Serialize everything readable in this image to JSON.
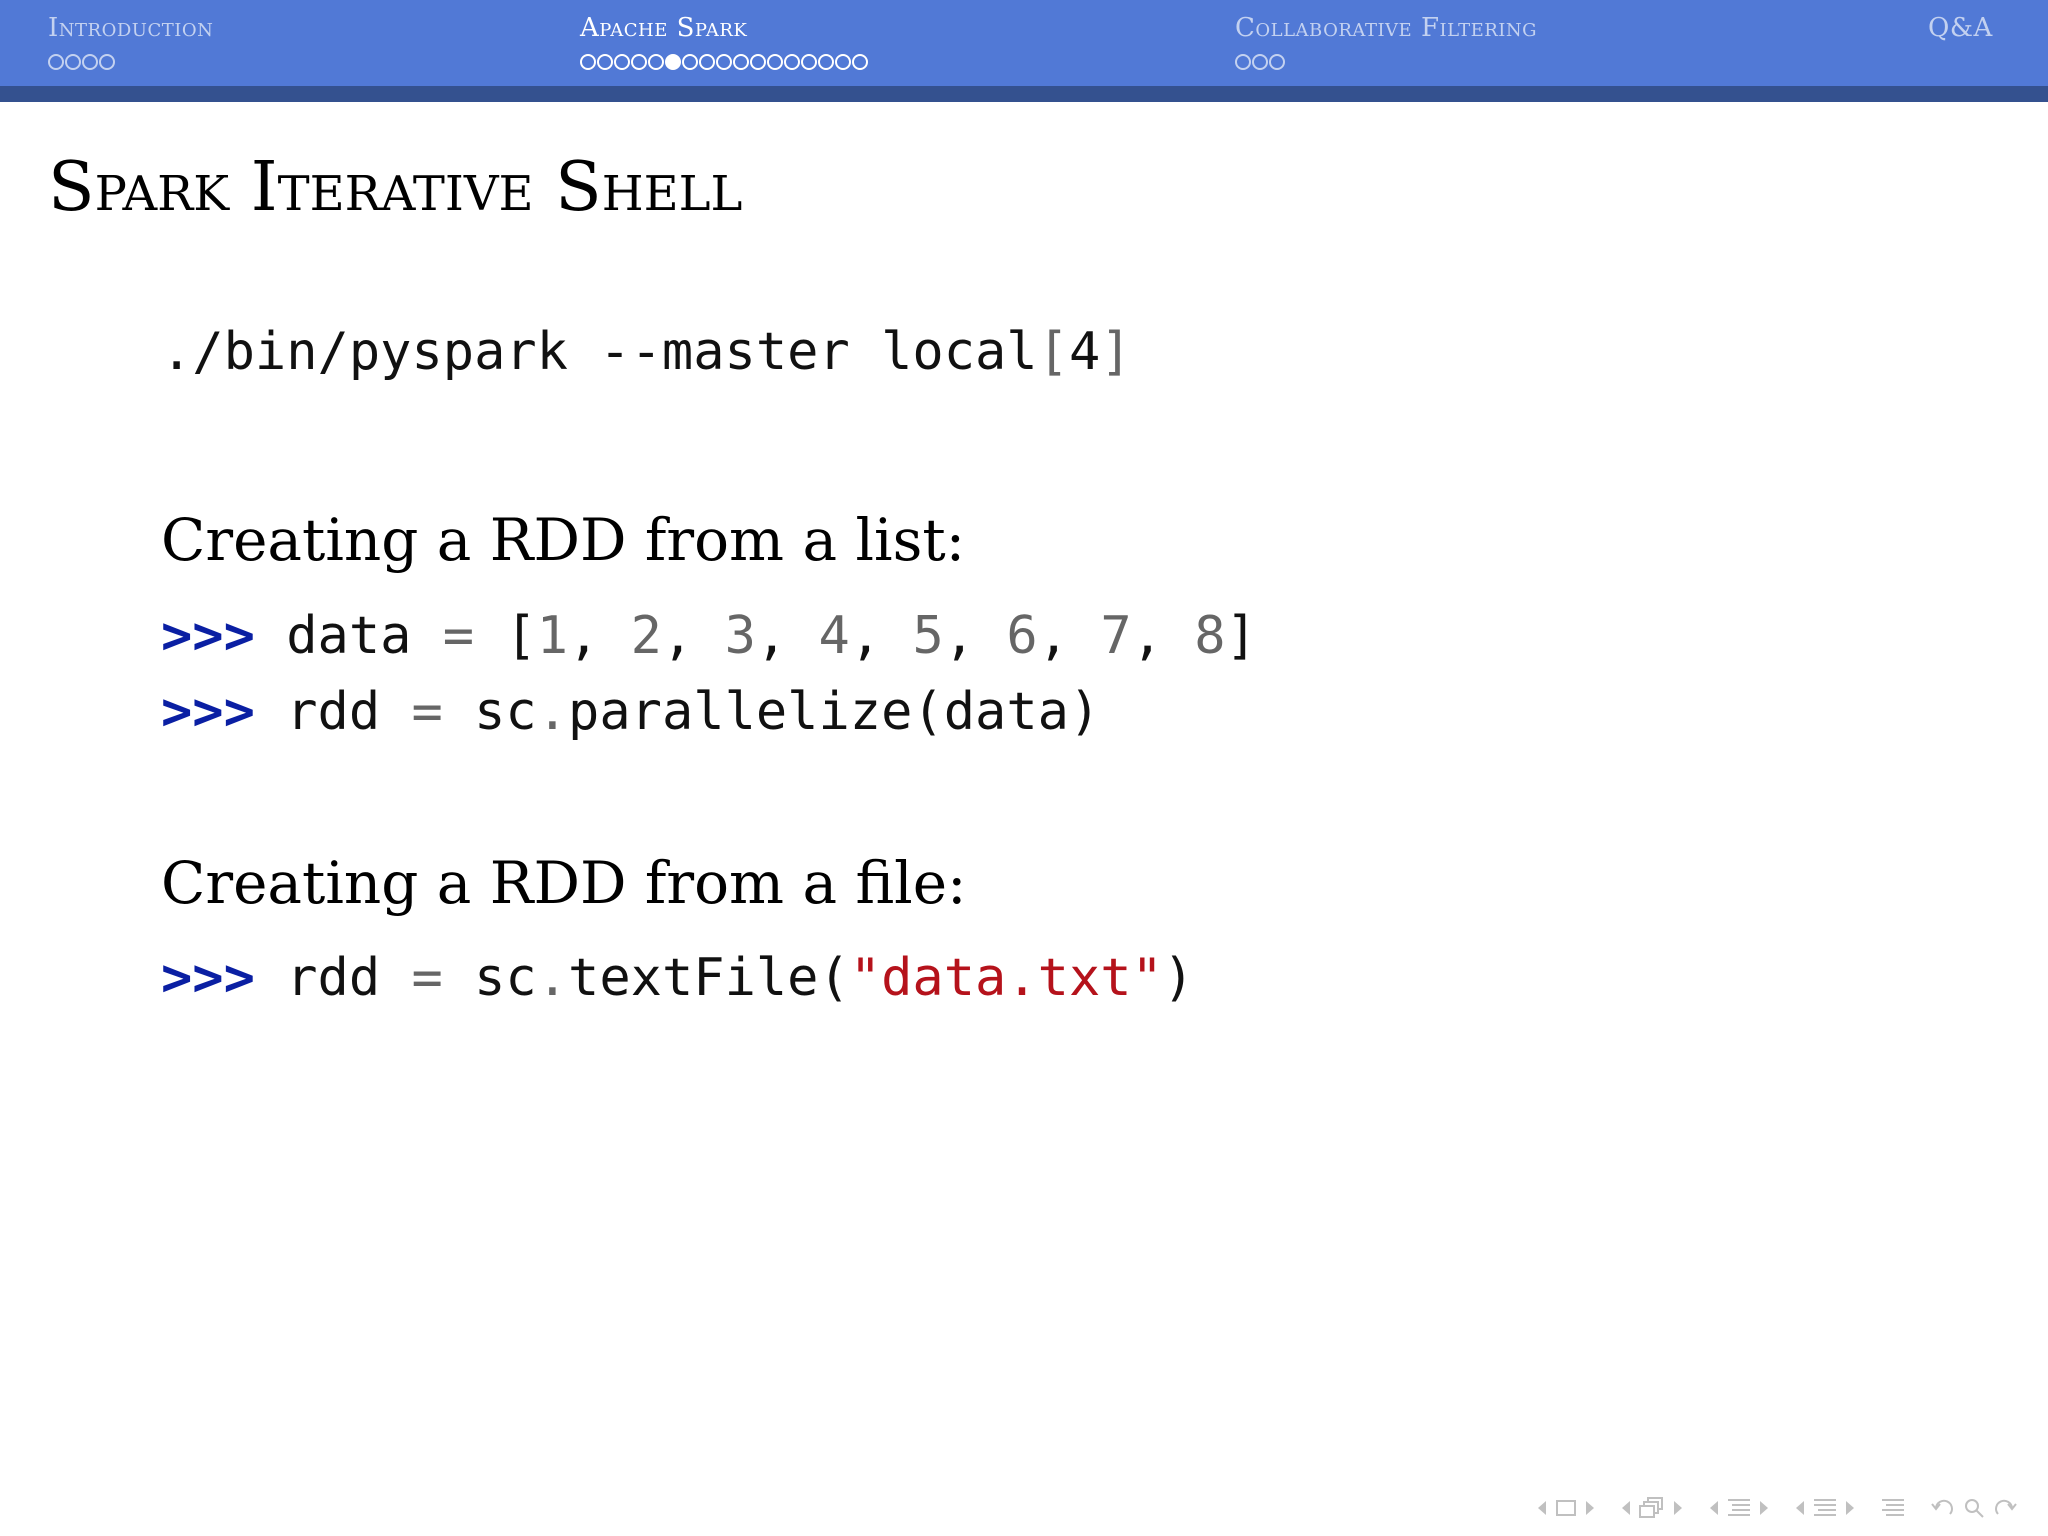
{
  "navbar": {
    "sections": [
      {
        "title": "Introduction",
        "dot_count": 4,
        "active_dot": -1
      },
      {
        "title": "Apache Spark",
        "dot_count": 17,
        "active_dot": 5
      },
      {
        "title": "Collaborative Filtering",
        "dot_count": 3,
        "active_dot": -1
      },
      {
        "title": "Q&A",
        "dot_count": 0,
        "active_dot": -1
      }
    ],
    "active_section": 1
  },
  "slide": {
    "title": "Spark Iterative Shell",
    "command": {
      "path": "./bin/pyspark",
      "flag": "--master",
      "arg": "local",
      "open_bracket": "[",
      "arg_num": "4",
      "close_bracket": "]"
    },
    "list_heading": "Creating a RDD from a list:",
    "list_lines": {
      "prompt": ">>>",
      "line1": {
        "var": "data",
        "eq": "=",
        "open": "[",
        "items": [
          "1",
          "2",
          "3",
          "4",
          "5",
          "6",
          "7",
          "8"
        ],
        "close": "]"
      },
      "line2": {
        "var": "rdd",
        "eq": "=",
        "obj": "sc",
        "dot": ".",
        "call": "parallelize(data)"
      }
    },
    "file_heading": "Creating a RDD from a file:",
    "file_line": {
      "prompt": ">>>",
      "var": "rdd",
      "eq": "=",
      "obj": "sc",
      "dot": ".",
      "func": "textFile(",
      "string": "\"data.txt\"",
      "close": ")"
    }
  },
  "colors": {
    "navbar_bg": "#5179d6",
    "navbar_shade": "#34518f",
    "prompt": "#0a1fa3",
    "string": "#b5121b"
  }
}
